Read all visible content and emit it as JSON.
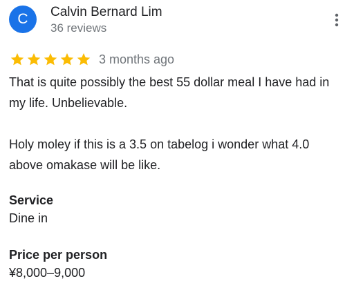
{
  "author": {
    "initial": "C",
    "name": "Calvin Bernard Lim",
    "reviews_count": "36 reviews",
    "avatar_color": "#1a73e8"
  },
  "menu": {
    "icon": "more-vert-icon"
  },
  "rating": {
    "stars": 5,
    "max_stars": 5,
    "star_color": "#fbbc04",
    "date": "3 months ago"
  },
  "review": {
    "paragraphs": [
      "That is quite possibly the best 55 dollar meal I have had in my life. Unbelievable.",
      "Holy moley if this is a 3.5 on tabelog i wonder what 4.0 above omakase will be like."
    ]
  },
  "details": [
    {
      "label": "Service",
      "value": "Dine in"
    },
    {
      "label": "Price per person",
      "value": "¥8,000–9,000"
    }
  ]
}
